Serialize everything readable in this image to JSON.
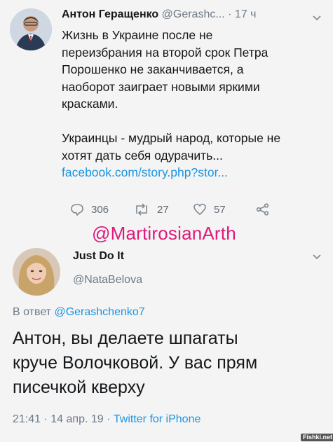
{
  "tweet1": {
    "author_name": "Антон Геращенко",
    "handle": "@Gerashc...",
    "time": "· 17 ч",
    "text_lines": [
      "Жизнь в Украине после не",
      "переизбрания на второй срок Петра",
      "Порошенко не заканчивается, а",
      "наоборот заиграет новыми яркими",
      "красками.",
      "",
      "Украинцы - мудрый народ, которые не",
      "хотят дать себя одурачить..."
    ],
    "link": "facebook.com/story.php?stor...",
    "replies": "306",
    "retweets": "27",
    "likes": "57"
  },
  "watermark": "@MartirosianArth",
  "tweet2": {
    "author_name": "Just Do It",
    "handle": "@NataBelova",
    "reply_prefix": "В ответ",
    "reply_to": "@Gerashchenko7",
    "text_lines": [
      "Антон, вы делаете шпагаты",
      "круче Волочковой. У вас прям",
      "писечкой кверху"
    ],
    "meta": "21:41 · 14 апр. 19 · ",
    "source": "Twitter for iPhone"
  },
  "site_badge": "Fishki.net",
  "colors": {
    "link": "#1b95e0",
    "watermark": "#e0197a"
  }
}
